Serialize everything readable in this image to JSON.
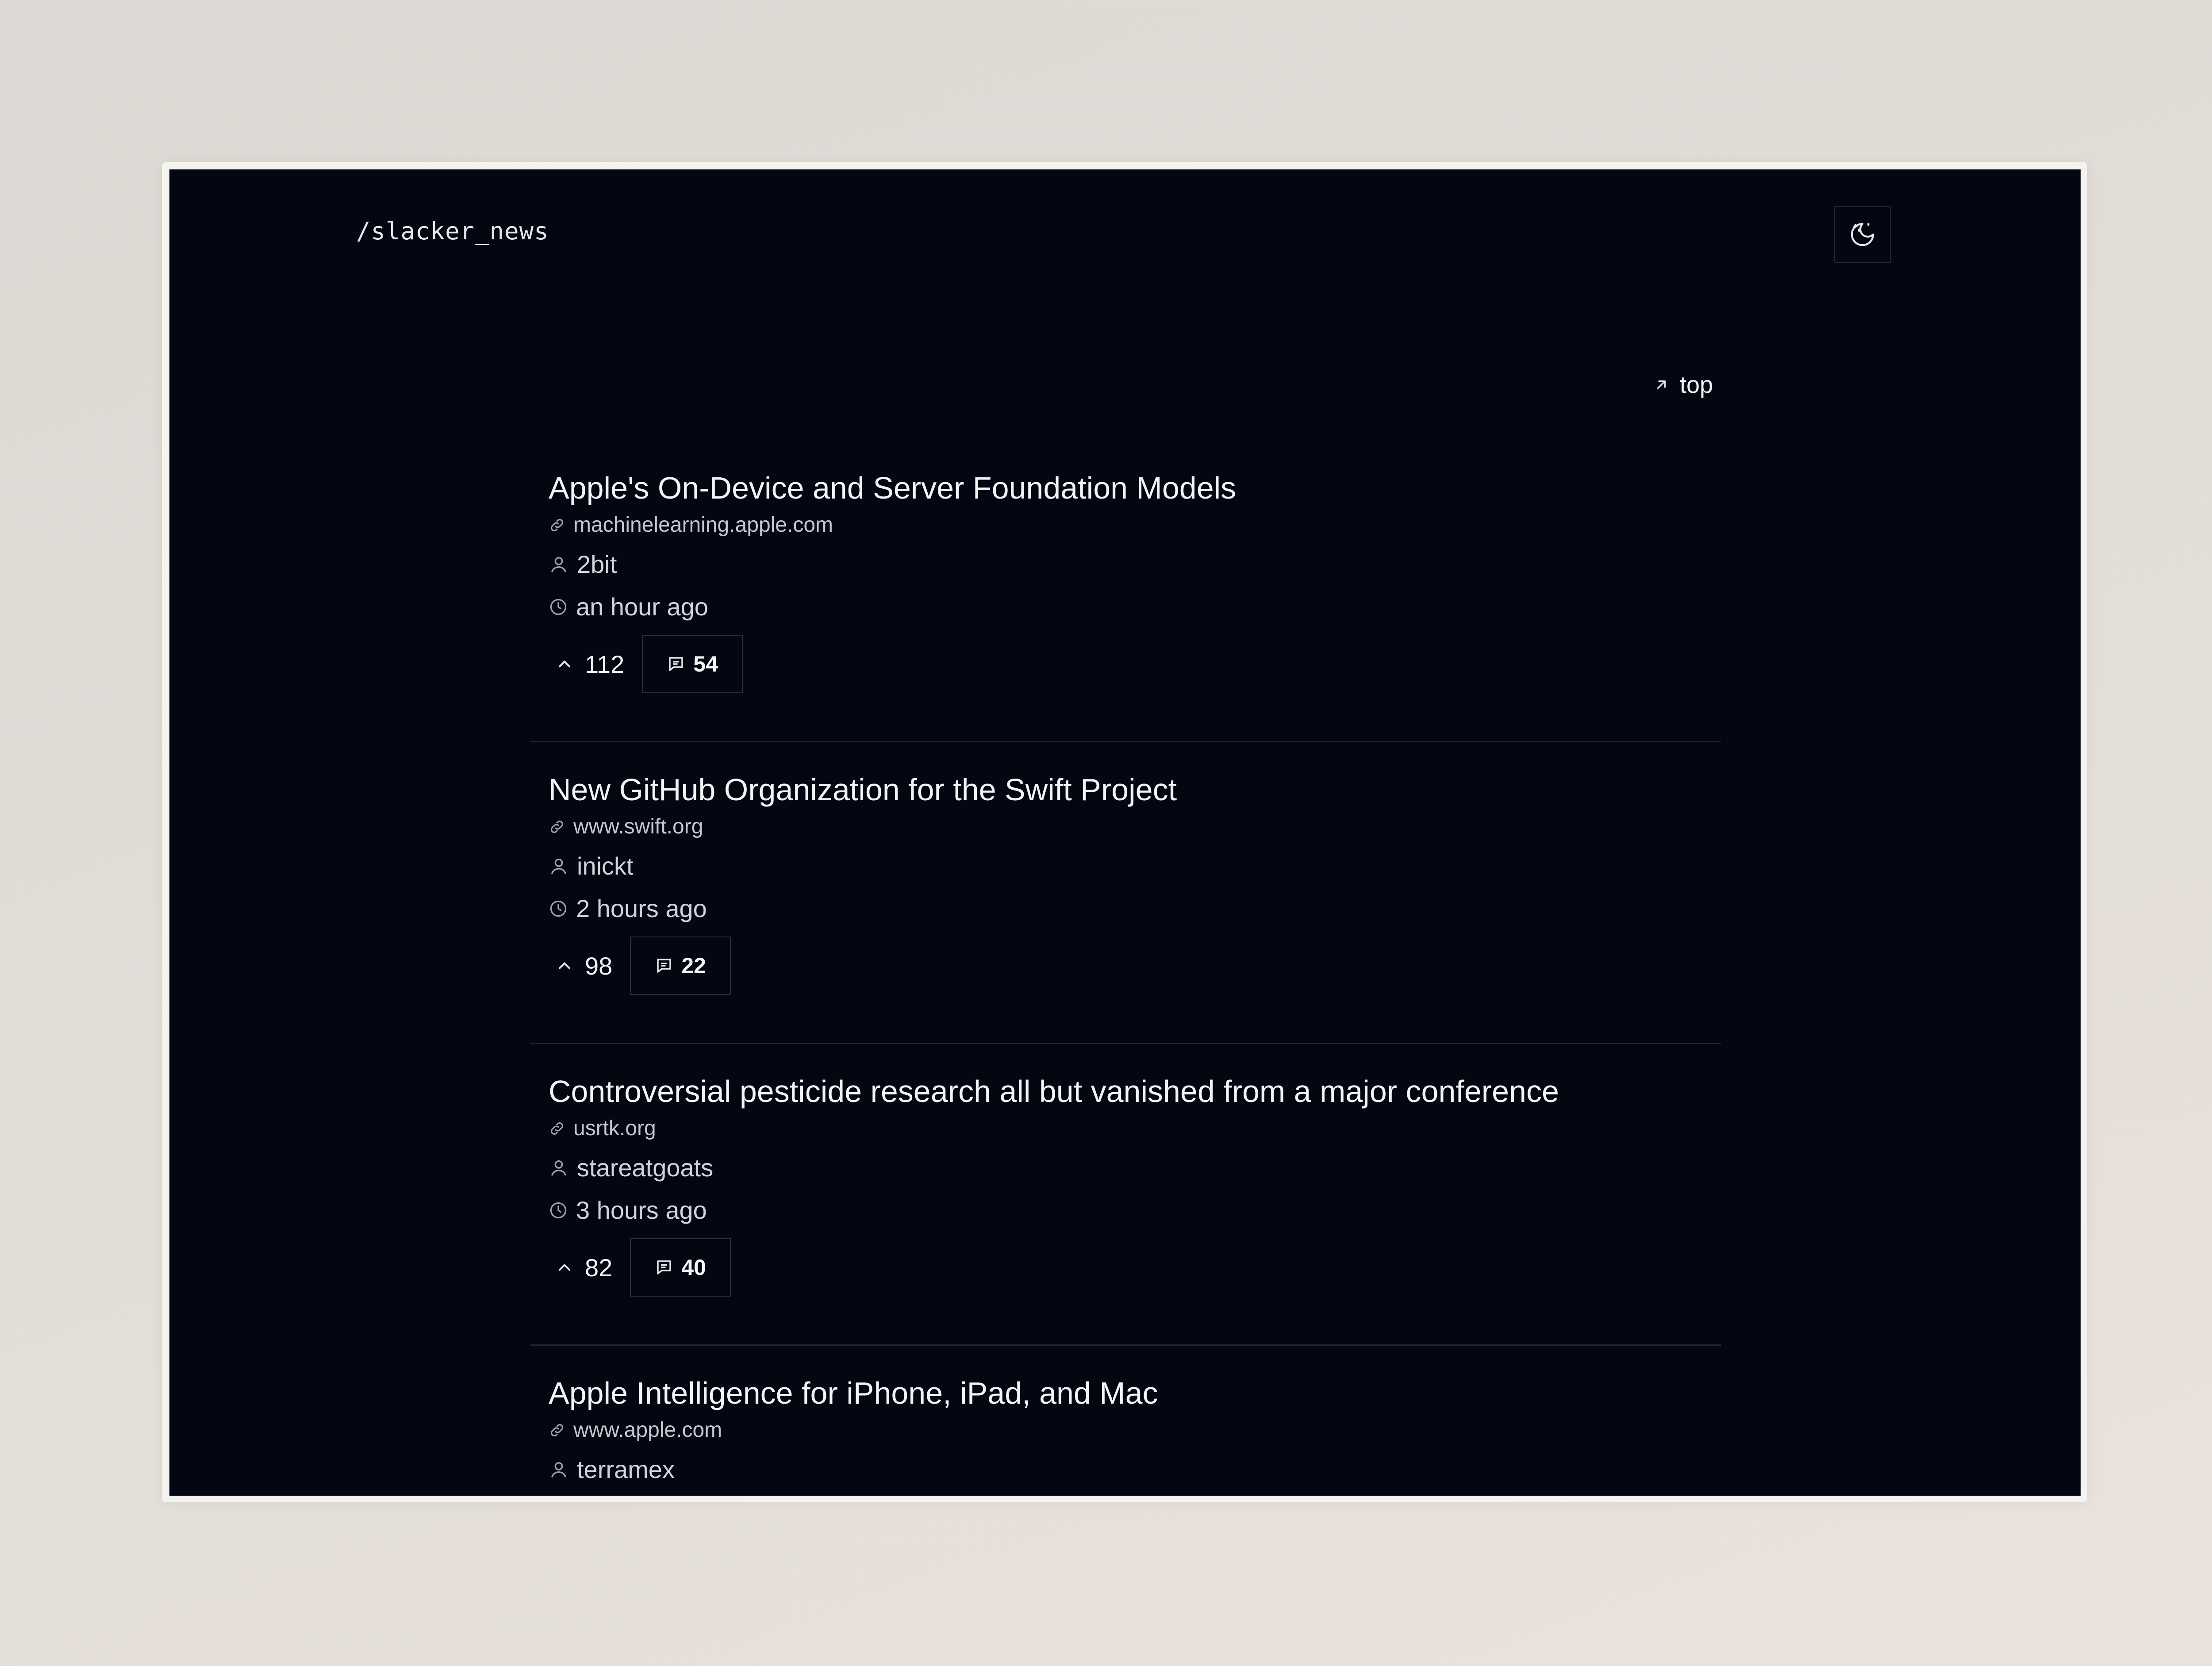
{
  "header": {
    "logo": "/slacker_news",
    "theme_toggle_icon": "moon-stars-icon"
  },
  "sort": {
    "label": "top",
    "icon": "arrow-up-right-icon"
  },
  "colors": {
    "background": "#030712",
    "text": "#f3f4f6",
    "muted": "#c4c8cf",
    "border": "#2a2f3a"
  },
  "stories": [
    {
      "title": "Apple's On-Device and Server Foundation Models",
      "domain": "machinelearning.apple.com",
      "user": "2bit",
      "time": "an hour ago",
      "points": "112",
      "comments": "54"
    },
    {
      "title": "New GitHub Organization for the Swift Project",
      "domain": "www.swift.org",
      "user": "inickt",
      "time": "2 hours ago",
      "points": "98",
      "comments": "22"
    },
    {
      "title": "Controversial pesticide research all but vanished from a major conference",
      "domain": "usrtk.org",
      "user": "stareatgoats",
      "time": "3 hours ago",
      "points": "82",
      "comments": "40"
    },
    {
      "title": "Apple Intelligence for iPhone, iPad, and Mac",
      "domain": "www.apple.com",
      "user": "terramex"
    }
  ]
}
